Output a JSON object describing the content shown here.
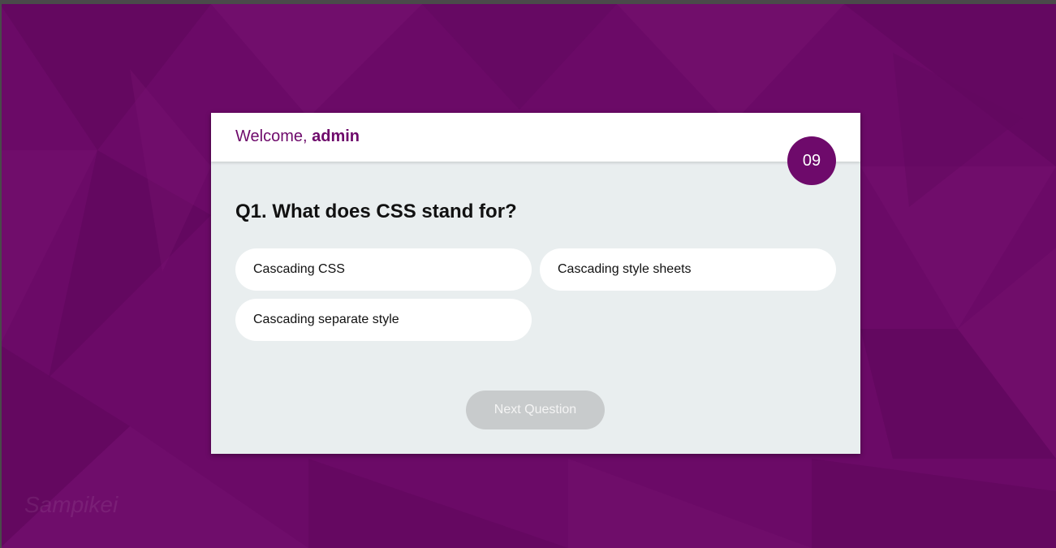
{
  "app": {
    "welcome_prefix": "Welcome, ",
    "username": "admin"
  },
  "timer": {
    "value": "09"
  },
  "quiz": {
    "question": "Q1. What does CSS stand for?",
    "options": [
      "Cascading CSS",
      "Cascading style sheets",
      "Cascading separate style"
    ],
    "next_label": "Next Question"
  },
  "watermark": {
    "text": "Sampikei"
  },
  "colors": {
    "background": "#6b0a67",
    "accent": "#6e0a6b",
    "card_body": "#e9eeef",
    "disabled_button": "#c8cbcc"
  }
}
